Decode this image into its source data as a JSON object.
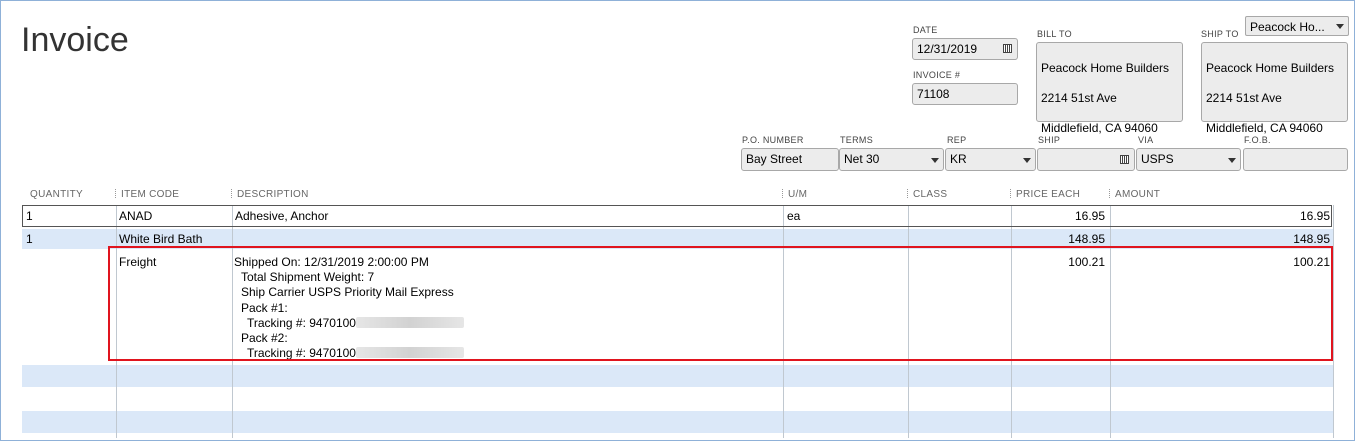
{
  "form": {
    "title": "Invoice"
  },
  "header": {
    "date_label": "DATE",
    "date_value": "12/31/2019",
    "invoice_label": "INVOICE #",
    "invoice_value": "71108",
    "bill_to_label": "BILL TO",
    "bill_to": [
      "Peacock Home Builders",
      "2214 51st Ave",
      "Middlefield, CA 94060"
    ],
    "ship_to_label": "SHIP TO",
    "ship_to_select": "Peacock Ho...",
    "ship_to": [
      "Peacock Home Builders",
      "2214 51st Ave",
      "Middlefield, CA 94060"
    ]
  },
  "fields": {
    "po_label": "P.O. NUMBER",
    "po_value": "Bay Street",
    "terms_label": "TERMS",
    "terms_value": "Net 30",
    "rep_label": "REP",
    "rep_value": "KR",
    "ship_label": "SHIP",
    "ship_value": "",
    "via_label": "VIA",
    "via_value": "USPS",
    "fob_label": "F.O.B.",
    "fob_value": ""
  },
  "columns": [
    "QUANTITY",
    "ITEM CODE",
    "DESCRIPTION",
    "U/M",
    "CLASS",
    "PRICE EACH",
    "AMOUNT"
  ],
  "rows": [
    {
      "qty": "1",
      "item": "ANAD",
      "desc": "Adhesive, Anchor",
      "um": "ea",
      "cls": "",
      "price": "16.95",
      "amount": "16.95"
    },
    {
      "qty": "1",
      "item": "White Bird Bath",
      "desc": "",
      "um": "",
      "cls": "",
      "price": "148.95",
      "amount": "148.95"
    },
    {
      "qty": "",
      "item": "Freight",
      "um": "",
      "cls": "",
      "price": "100.21",
      "amount": "100.21",
      "desc_lines": [
        "Shipped On: 12/31/2019 2:00:00 PM",
        "  Total Shipment Weight: 7",
        "  Ship Carrier USPS Priority Mail Express",
        "  Pack #1:",
        "    Tracking #: 9470100",
        "  Pack #2:",
        "    Tracking #: 9470100"
      ]
    }
  ],
  "colors": {
    "highlight": "#e0141e",
    "row_blue": "#dbe8f8",
    "frame": "#8fb1d8"
  }
}
